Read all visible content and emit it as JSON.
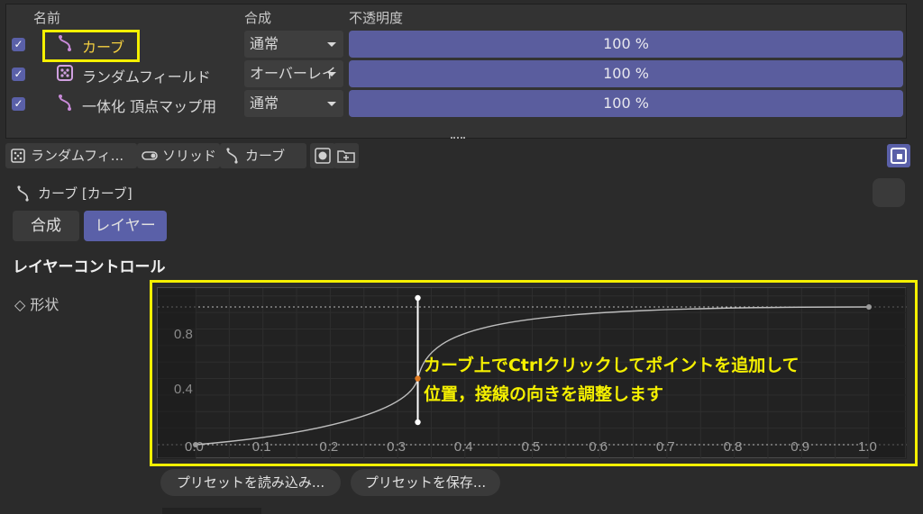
{
  "layer_list": {
    "columns": {
      "name": "名前",
      "blend": "合成",
      "opacity": "不透明度"
    },
    "rows": [
      {
        "name": "カーブ",
        "checked": "✓",
        "blend": "通常",
        "opacity": "100 %",
        "icon": "curve-icon",
        "highlighted": true
      },
      {
        "name": "ランダムフィールド",
        "checked": "✓",
        "blend": "オーバーレイ",
        "opacity": "100 %",
        "icon": "dice-icon"
      },
      {
        "name": "一体化 頂点マップ用",
        "checked": "✓",
        "blend": "通常",
        "opacity": "100 %",
        "icon": "curve-icon"
      }
    ]
  },
  "tabs": [
    {
      "label": "ランダムフィ...",
      "icon": "dice-icon"
    },
    {
      "label": "ソリッド",
      "icon": "toggle-icon"
    },
    {
      "label": "カーブ",
      "icon": "curve-icon"
    }
  ],
  "attributes": {
    "title": "カーブ [カーブ]",
    "mode_buttons": [
      "合成",
      "レイヤー"
    ],
    "active_mode": "レイヤー",
    "section_title": "レイヤーコントロール",
    "shape_label": "◇ 形状"
  },
  "curve_editor": {
    "y_ticks": [
      "0.8",
      "0.4"
    ],
    "x_ticks": [
      "0.0",
      "0.1",
      "0.2",
      "0.3",
      "0.4",
      "0.5",
      "0.6",
      "0.7",
      "0.8",
      "0.9",
      "1.0"
    ],
    "annotation_line1": "カーブ上でCtrlクリックしてポイントを追加して",
    "annotation_line2": "位置，接線の向きを調整します",
    "curve_points": [
      {
        "x": 0.0,
        "y": 0.0
      },
      {
        "x": 0.33,
        "y": 0.48
      },
      {
        "x": 1.0,
        "y": 1.0
      }
    ]
  },
  "presets": {
    "load": "プリセットを読み込み...",
    "save": "プリセットを保存..."
  },
  "colors": {
    "accent": "#5a60a8",
    "highlight": "#f5f000",
    "curve_icon": "#c88ad8",
    "point_selected": "#e07a20"
  }
}
